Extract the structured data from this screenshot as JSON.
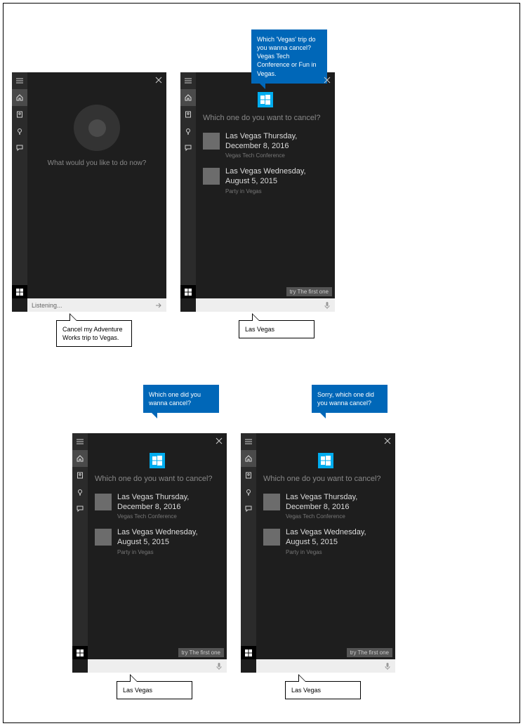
{
  "panels": {
    "p1": {
      "greeting": "What would you like to do now?",
      "input": "Listening...",
      "callout": "Cancel my Adventure Works trip to Vegas."
    },
    "p2": {
      "bubble": "Which 'Vegas' trip do you wanna cancel? Vegas Tech Conference or Fun in Vegas.",
      "prompt": "Which one do you want to cancel?",
      "hint": "try The first one",
      "callout": "Las Vegas"
    },
    "p3": {
      "bubble": "Which one did you wanna cancel?",
      "prompt": "Which one do you want to cancel?",
      "hint": "try The first one",
      "callout": "Las Vegas"
    },
    "p4": {
      "bubble": "Sorry, which one did you wanna cancel?",
      "prompt": "Which one do you want to cancel?",
      "hint": "try The first one",
      "callout": "Las Vegas"
    }
  },
  "options": [
    {
      "title": "Las Vegas Thursday, December 8, 2016",
      "sub": "Vegas Tech Conference"
    },
    {
      "title": "Las Vegas Wednesday, August 5, 2015",
      "sub": "Party in Vegas"
    }
  ],
  "sidebar_icons": [
    "menu",
    "home",
    "notebook",
    "bulb",
    "settings"
  ],
  "colors": {
    "accent": "#0067b8",
    "app_tile": "#00adef"
  }
}
